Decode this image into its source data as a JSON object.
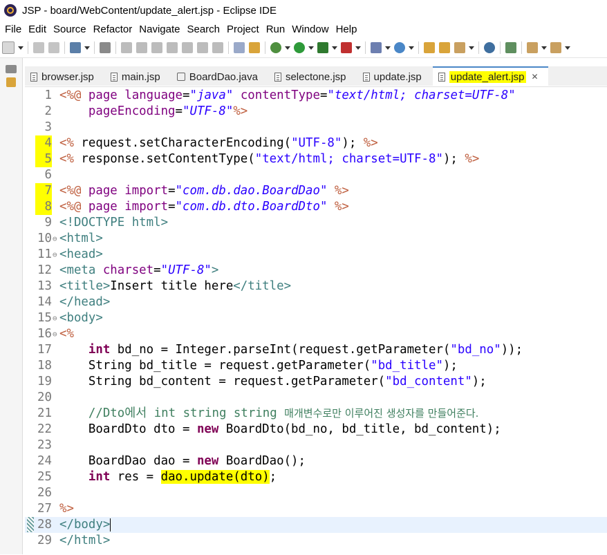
{
  "window": {
    "title": "JSP - board/WebContent/update_alert.jsp - Eclipse IDE"
  },
  "menu": [
    "File",
    "Edit",
    "Source",
    "Refactor",
    "Navigate",
    "Search",
    "Project",
    "Run",
    "Window",
    "Help"
  ],
  "tabs": [
    {
      "label": "browser.jsp",
      "kind": "jsp"
    },
    {
      "label": "main.jsp",
      "kind": "jsp"
    },
    {
      "label": "BoardDao.java",
      "kind": "java"
    },
    {
      "label": "selectone.jsp",
      "kind": "jsp"
    },
    {
      "label": "update.jsp",
      "kind": "jsp"
    },
    {
      "label": "update_alert.jsp",
      "kind": "jsp",
      "active": true
    }
  ],
  "editor": {
    "current_line": 28,
    "lines": [
      {
        "n": 1,
        "tokens": [
          [
            "tok-jsp",
            "<%@ "
          ],
          [
            "tok-attr",
            "page "
          ],
          [
            "tok-attr",
            "language"
          ],
          [
            "tok-txt",
            "="
          ],
          [
            "tok-str",
            "\"java\""
          ],
          [
            "tok-txt",
            " "
          ],
          [
            "tok-attr",
            "contentType"
          ],
          [
            "tok-txt",
            "="
          ],
          [
            "tok-str",
            "\"text/html; charset=UTF-8\""
          ]
        ]
      },
      {
        "n": 2,
        "tokens": [
          [
            "tok-txt",
            "    "
          ],
          [
            "tok-attr",
            "pageEncoding"
          ],
          [
            "tok-txt",
            "="
          ],
          [
            "tok-str",
            "\"UTF-8\""
          ],
          [
            "tok-jsp",
            "%>"
          ]
        ]
      },
      {
        "n": 3,
        "tokens": []
      },
      {
        "n": 4,
        "hl": true,
        "tokens": [
          [
            "tok-jsp",
            "<%"
          ],
          [
            "tok-txt",
            " request.setCharacterEncoding("
          ],
          [
            "tok-jstr",
            "\"UTF-8\""
          ],
          [
            "tok-txt",
            "); "
          ],
          [
            "tok-jsp",
            "%>"
          ]
        ]
      },
      {
        "n": 5,
        "hl": true,
        "tokens": [
          [
            "tok-jsp",
            "<%"
          ],
          [
            "tok-txt",
            " response.setContentType("
          ],
          [
            "tok-jstr",
            "\"text/html; charset=UTF-8\""
          ],
          [
            "tok-txt",
            "); "
          ],
          [
            "tok-jsp",
            "%>"
          ]
        ]
      },
      {
        "n": 6,
        "tokens": []
      },
      {
        "n": 7,
        "hl": true,
        "tokens": [
          [
            "tok-jsp",
            "<%@ "
          ],
          [
            "tok-attr",
            "page "
          ],
          [
            "tok-attr",
            "import"
          ],
          [
            "tok-txt",
            "="
          ],
          [
            "tok-str",
            "\"com.db.dao.BoardDao\""
          ],
          [
            "tok-txt",
            " "
          ],
          [
            "tok-jsp",
            "%>"
          ]
        ]
      },
      {
        "n": 8,
        "hl": true,
        "tokens": [
          [
            "tok-jsp",
            "<%@ "
          ],
          [
            "tok-attr",
            "page "
          ],
          [
            "tok-attr",
            "import"
          ],
          [
            "tok-txt",
            "="
          ],
          [
            "tok-str",
            "\"com.db.dto.BoardDto\""
          ],
          [
            "tok-txt",
            " "
          ],
          [
            "tok-jsp",
            "%>"
          ]
        ]
      },
      {
        "n": 9,
        "tokens": [
          [
            "tok-tag",
            "<!DOCTYPE "
          ],
          [
            "tok-tag",
            "html"
          ],
          [
            "tok-tag",
            ">"
          ]
        ]
      },
      {
        "n": 10,
        "fold": true,
        "tokens": [
          [
            "tok-tag",
            "<html>"
          ]
        ]
      },
      {
        "n": 11,
        "fold": true,
        "tokens": [
          [
            "tok-tag",
            "<head>"
          ]
        ]
      },
      {
        "n": 12,
        "tokens": [
          [
            "tok-tag",
            "<meta "
          ],
          [
            "tok-attr",
            "charset"
          ],
          [
            "tok-txt",
            "="
          ],
          [
            "tok-str",
            "\"UTF-8\""
          ],
          [
            "tok-tag",
            ">"
          ]
        ]
      },
      {
        "n": 13,
        "tokens": [
          [
            "tok-tag",
            "<title>"
          ],
          [
            "tok-txt",
            "Insert title here"
          ],
          [
            "tok-tag",
            "</title>"
          ]
        ]
      },
      {
        "n": 14,
        "tokens": [
          [
            "tok-tag",
            "</head>"
          ]
        ]
      },
      {
        "n": 15,
        "fold": true,
        "tokens": [
          [
            "tok-tag",
            "<body>"
          ]
        ]
      },
      {
        "n": 16,
        "fold": true,
        "tokens": [
          [
            "tok-jsp",
            "<%"
          ]
        ]
      },
      {
        "n": 17,
        "tokens": [
          [
            "tok-txt",
            "    "
          ],
          [
            "tok-kw",
            "int"
          ],
          [
            "tok-txt",
            " bd_no = Integer.parseInt(request.getParameter("
          ],
          [
            "tok-jstr",
            "\"bd_no\""
          ],
          [
            "tok-txt",
            "));"
          ]
        ]
      },
      {
        "n": 18,
        "tokens": [
          [
            "tok-txt",
            "    String bd_title = request.getParameter("
          ],
          [
            "tok-jstr",
            "\"bd_title\""
          ],
          [
            "tok-txt",
            ");"
          ]
        ]
      },
      {
        "n": 19,
        "tokens": [
          [
            "tok-txt",
            "    String bd_content = request.getParameter("
          ],
          [
            "tok-jstr",
            "\"bd_content\""
          ],
          [
            "tok-txt",
            ");"
          ]
        ]
      },
      {
        "n": 20,
        "tokens": []
      },
      {
        "n": 21,
        "tokens": [
          [
            "tok-txt",
            "    "
          ],
          [
            "tok-cmt",
            "//Dto에서 int string string "
          ],
          [
            "tok-cmt small-kr",
            "매개변수로만 이루어진 생성자를 만들어준다."
          ]
        ]
      },
      {
        "n": 22,
        "tokens": [
          [
            "tok-txt",
            "    BoardDto dto = "
          ],
          [
            "tok-kw",
            "new"
          ],
          [
            "tok-txt",
            " BoardDto(bd_no, bd_title, bd_content);"
          ]
        ]
      },
      {
        "n": 23,
        "tokens": []
      },
      {
        "n": 24,
        "tokens": [
          [
            "tok-txt",
            "    BoardDao dao = "
          ],
          [
            "tok-kw",
            "new"
          ],
          [
            "tok-txt",
            " BoardDao();"
          ]
        ]
      },
      {
        "n": 25,
        "tokens": [
          [
            "tok-txt",
            "    "
          ],
          [
            "tok-kw",
            "int"
          ],
          [
            "tok-txt",
            " res = "
          ],
          [
            "tok-txt hl-yellow",
            "dao.update(dto)"
          ],
          [
            "tok-txt",
            ";"
          ]
        ]
      },
      {
        "n": 26,
        "tokens": []
      },
      {
        "n": 27,
        "tokens": [
          [
            "tok-jsp",
            "%>"
          ]
        ]
      },
      {
        "n": 28,
        "tokens": [
          [
            "tok-tag",
            "</body>"
          ]
        ],
        "caret": true
      },
      {
        "n": 29,
        "tokens": [
          [
            "tok-tag",
            "</html>"
          ]
        ]
      }
    ]
  }
}
